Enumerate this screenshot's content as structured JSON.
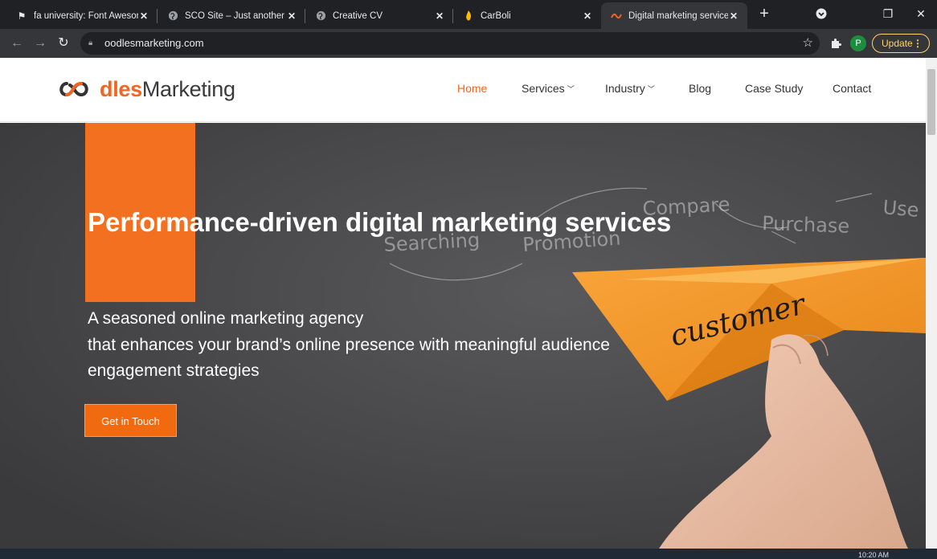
{
  "browser": {
    "tabs": [
      {
        "title": "fa university: Font Aweson",
        "icon": "flag-icon"
      },
      {
        "title": "SCO Site – Just another W",
        "icon": "globe-icon"
      },
      {
        "title": "Creative CV",
        "icon": "globe-icon"
      },
      {
        "title": "CarBoli",
        "icon": "flame-icon"
      },
      {
        "title": "Digital marketing services",
        "icon": "oodles-icon",
        "active": true
      }
    ],
    "url": "oodlesmarketing.com",
    "profile_initial": "P",
    "update_label": "Update"
  },
  "site": {
    "logo": {
      "part1": "dles",
      "part2": "Marketing"
    },
    "nav": [
      {
        "label": "Home",
        "active": true
      },
      {
        "label": "Services",
        "dropdown": true
      },
      {
        "label": "Industry",
        "dropdown": true
      },
      {
        "label": "Blog"
      },
      {
        "label": "Case Study"
      },
      {
        "label": "Contact"
      }
    ],
    "hero": {
      "title": "Performance-driven digital marketing services",
      "subtitle_lines": [
        "A seasoned  online marketing agency",
        "that enhances your brand’s online presence with meaningful audience",
        "engagement strategies"
      ],
      "cta": "Get in Touch",
      "image_words": [
        "Searching",
        "Promotion",
        "Compare",
        "Purchase",
        "Use",
        "customer"
      ]
    }
  },
  "taskbar": {
    "time": "10:20 AM"
  },
  "colors": {
    "accent": "#f26522",
    "hero_bg": "#4a4a4c",
    "chrome_dark": "#202124"
  }
}
